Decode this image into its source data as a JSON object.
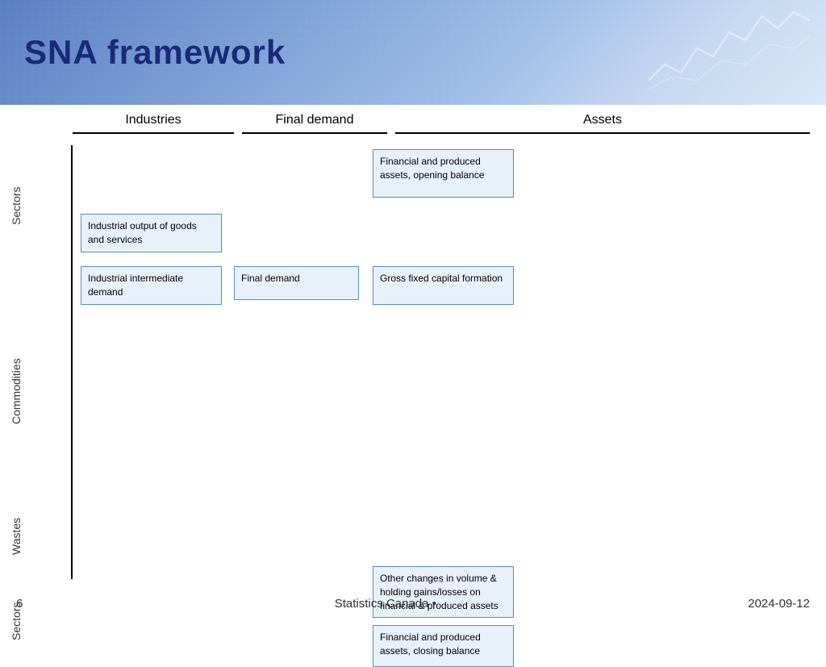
{
  "header": {
    "title": "SNA framework"
  },
  "columns": {
    "industries": "Industries",
    "final_demand": "Final demand",
    "assets": "Assets"
  },
  "row_labels": {
    "sectors_top": "Sectors",
    "commodities": "Commodities",
    "wastes": "Wastes",
    "sectors_bottom": "Sectors"
  },
  "boxes": {
    "financial_opening": "Financial and produced assets, opening balance",
    "industrial_output": "Industrial output of goods and services",
    "industrial_intermediate": "Industrial intermediate demand",
    "final_demand_box": "Final demand",
    "gross_fixed_capital": "Gross fixed capital formation",
    "other_changes": "Other changes in volume & holding gains/losses on financial & produced assets",
    "financial_closing": "Financial and produced assets, closing balance"
  },
  "footer": {
    "page_number": "6",
    "organization": "Statistics Canada •",
    "date": "2024-09-12"
  }
}
